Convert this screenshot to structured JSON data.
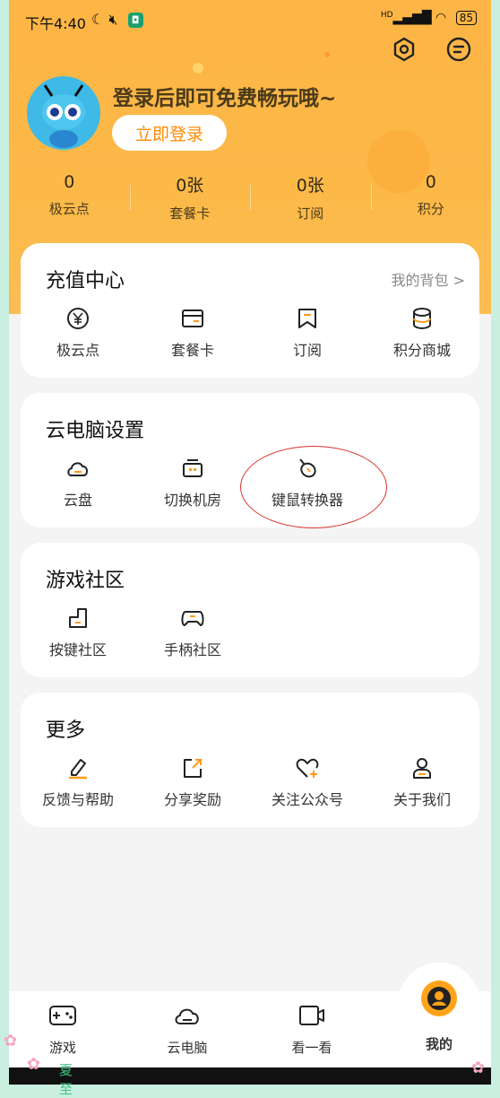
{
  "status_bar": {
    "time": "下午4:40",
    "network": "HD",
    "battery": "85"
  },
  "profile": {
    "login_prompt": "登录后即可免费畅玩哦~",
    "login_button": "立即登录"
  },
  "stats": [
    {
      "value": "0",
      "label": "极云点"
    },
    {
      "value": "0张",
      "label": "套餐卡"
    },
    {
      "value": "0张",
      "label": "订阅"
    },
    {
      "value": "0",
      "label": "积分"
    }
  ],
  "recharge": {
    "title": "充值中心",
    "link": "我的背包 >",
    "items": [
      {
        "label": "极云点",
        "icon": "coin-icon"
      },
      {
        "label": "套餐卡",
        "icon": "card-icon"
      },
      {
        "label": "订阅",
        "icon": "bookmark-icon"
      },
      {
        "label": "积分商城",
        "icon": "database-icon"
      }
    ]
  },
  "pc_settings": {
    "title": "云电脑设置",
    "items": [
      {
        "label": "云盘",
        "icon": "cloud-icon"
      },
      {
        "label": "切换机房",
        "icon": "server-icon"
      },
      {
        "label": "键鼠转换器",
        "icon": "mouse-icon"
      }
    ]
  },
  "community": {
    "title": "游戏社区",
    "items": [
      {
        "label": "按键社区",
        "icon": "keypad-icon"
      },
      {
        "label": "手柄社区",
        "icon": "gamepad-icon"
      }
    ]
  },
  "more": {
    "title": "更多",
    "items": [
      {
        "label": "反馈与帮助",
        "icon": "pencil-icon"
      },
      {
        "label": "分享奖励",
        "icon": "share-icon"
      },
      {
        "label": "关注公众号",
        "icon": "heart-plus-icon"
      },
      {
        "label": "关于我们",
        "icon": "person-icon"
      }
    ]
  },
  "tabs": [
    {
      "label": "游戏",
      "icon": "gamepad-icon"
    },
    {
      "label": "云电脑",
      "icon": "cloud-icon"
    },
    {
      "label": "看一看",
      "icon": "video-icon"
    },
    {
      "label": "我的",
      "icon": "profile-icon",
      "active": true
    }
  ],
  "watermark": "夏至",
  "colors": {
    "accent": "#ff8b00",
    "header": "#fdb545",
    "highlight_circle": "#d8332a"
  }
}
